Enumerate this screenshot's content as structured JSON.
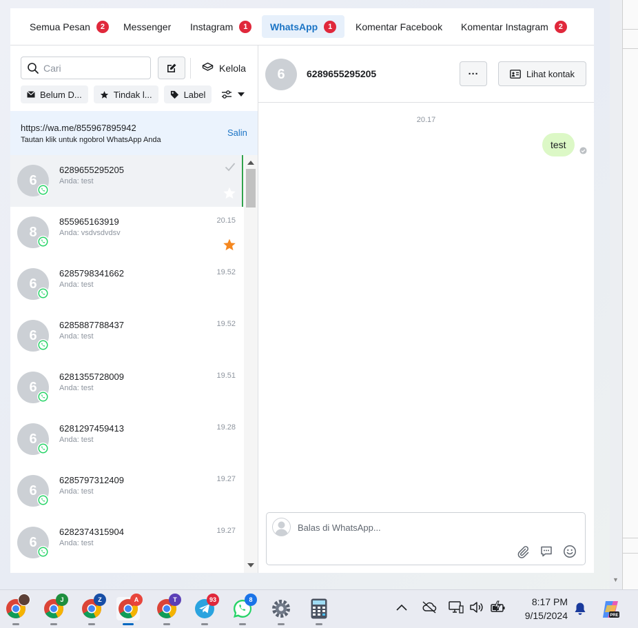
{
  "tabs": [
    {
      "label": "Semua Pesan",
      "badge": "2"
    },
    {
      "label": "Messenger",
      "badge": ""
    },
    {
      "label": "Instagram",
      "badge": "1"
    },
    {
      "label": "WhatsApp",
      "badge": "1"
    },
    {
      "label": "Komentar Facebook",
      "badge": ""
    },
    {
      "label": "Komentar Instagram",
      "badge": "2"
    }
  ],
  "sidebar": {
    "search_placeholder": "Cari",
    "manage_label": "Kelola",
    "filters": [
      "Belum D...",
      "Tindak l...",
      "Label"
    ],
    "link_banner": {
      "url": "https://wa.me/855967895942",
      "subtitle": "Tautan klik untuk ngobrol WhatsApp Anda",
      "copy_label": "Salin"
    }
  },
  "conversations": [
    {
      "initial": "6",
      "name": "6289655295205",
      "preview": "Anda: test",
      "time": "",
      "selected": true
    },
    {
      "initial": "8",
      "name": "855965163919",
      "preview": "Anda: vsdvsdvdsv",
      "time": "20.15",
      "starred": true
    },
    {
      "initial": "6",
      "name": "6285798341662",
      "preview": "Anda: test",
      "time": "19.52"
    },
    {
      "initial": "6",
      "name": "6285887788437",
      "preview": "Anda: test",
      "time": "19.52"
    },
    {
      "initial": "6",
      "name": "6281355728009",
      "preview": "Anda: test",
      "time": "19.51"
    },
    {
      "initial": "6",
      "name": "6281297459413",
      "preview": "Anda: test",
      "time": "19.28"
    },
    {
      "initial": "6",
      "name": "6285797312409",
      "preview": "Anda: test",
      "time": "19.27"
    },
    {
      "initial": "6",
      "name": "6282374315904",
      "preview": "Anda: test",
      "time": "19.27"
    }
  ],
  "chat": {
    "initial": "6",
    "title": "6289655295205",
    "more_label": "···",
    "contact_label": "Lihat kontak",
    "message_time": "20.17",
    "message_text": "test",
    "reply_placeholder": "Balas di WhatsApp..."
  },
  "taskbar": {
    "apps": [
      {
        "icon": "chrome-profile-photo-icon"
      },
      {
        "icon": "chrome-profile-j-icon",
        "letter": "J",
        "color": "#1e8e3e"
      },
      {
        "icon": "chrome-profile-z-icon",
        "letter": "Z",
        "color": "#174ea6"
      },
      {
        "icon": "chrome-profile-a-icon",
        "letter": "A",
        "color": "#e8453c"
      },
      {
        "icon": "chrome-profile-t-icon",
        "letter": "T",
        "color": "#5b3fb7"
      },
      {
        "icon": "telegram-icon",
        "badge": "93"
      },
      {
        "icon": "whatsapp-icon",
        "badge": "8"
      },
      {
        "icon": "settings-icon"
      },
      {
        "icon": "calculator-icon"
      }
    ],
    "time": "8:17 PM",
    "date": "9/15/2024"
  },
  "colors": {
    "accent": "#1b74c5",
    "badge": "#e0283b",
    "whatsapp": "#25d366",
    "bubble": "#dcf8c6",
    "star": "#f5871f"
  }
}
